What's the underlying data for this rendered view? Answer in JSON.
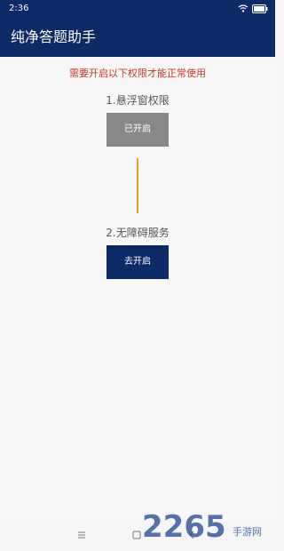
{
  "status_bar": {
    "time": "2:36"
  },
  "app_bar": {
    "title": "纯净答题助手"
  },
  "main": {
    "warning": "需要开启以下权限才能正常使用",
    "steps": [
      {
        "label": "1.悬浮窗权限",
        "button": "已开启"
      },
      {
        "label": "2.无障碍服务",
        "button": "去开启"
      }
    ]
  },
  "watermark": {
    "brand": "2265",
    "text": "手游网"
  },
  "colors": {
    "primary": "#0c2a66",
    "warning": "#c93a2a",
    "disabled_button": "#888888",
    "connector": "#e0a02a"
  },
  "icons": {
    "status": [
      "wifi-icon",
      "battery-icon"
    ],
    "navigation": [
      "menu-icon",
      "home-icon",
      "back-icon"
    ]
  }
}
